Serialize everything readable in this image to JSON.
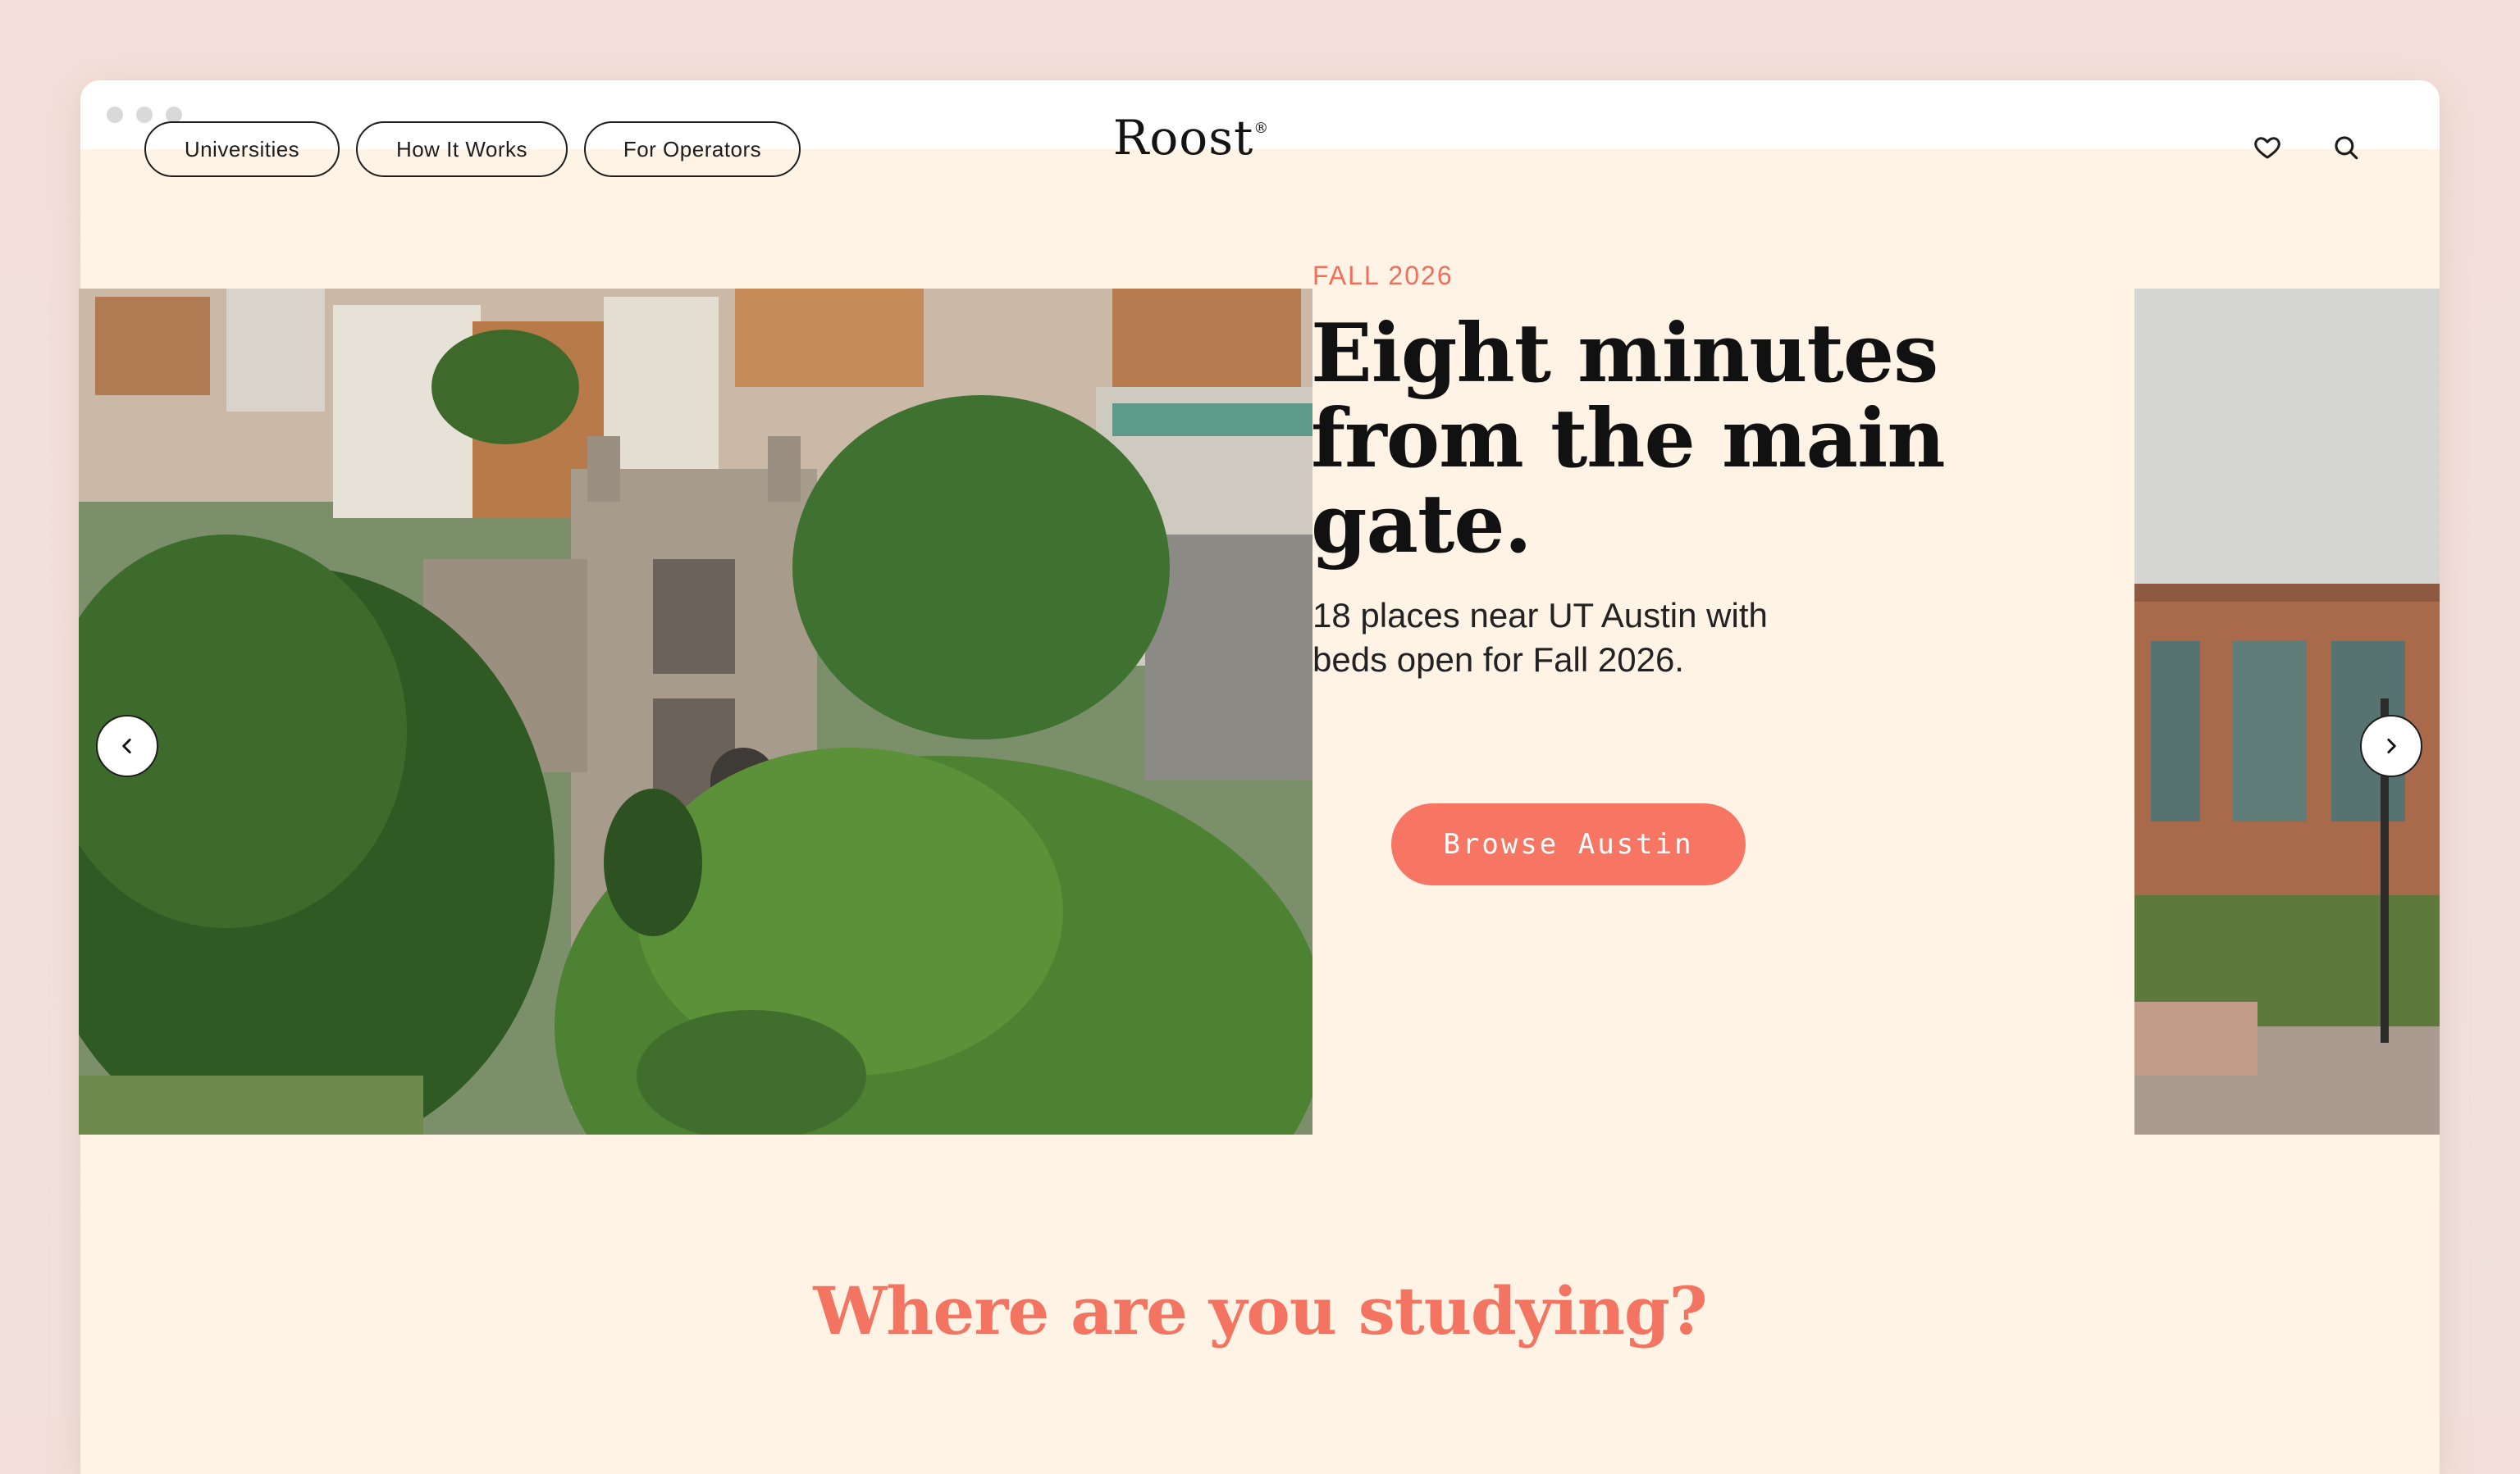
{
  "window": {
    "controls": [
      "close",
      "minimize",
      "maximize"
    ]
  },
  "nav": {
    "links": [
      {
        "label": "Universities"
      },
      {
        "label": "How It Works"
      },
      {
        "label": "For Operators"
      }
    ],
    "logo": "Roost",
    "logo_mark": "®",
    "icons": [
      "heart-icon",
      "search-icon"
    ]
  },
  "hero": {
    "eyebrow": "FALL 2026",
    "headline_lines": [
      "Eight minutes",
      "from the main",
      "gate."
    ],
    "subtext_lines": [
      "18 places near UT Austin with",
      "beds open for Fall 2026."
    ],
    "cta_label": "Browse Austin",
    "prev_icon": "chevron-left-icon",
    "next_icon": "chevron-right-icon"
  },
  "colors": {
    "page_bg": "#fff3e6",
    "accent": "#f67563",
    "eyebrow": "#ef6f5a",
    "text": "#111111"
  },
  "section": {
    "title": "Where are you studying?"
  }
}
